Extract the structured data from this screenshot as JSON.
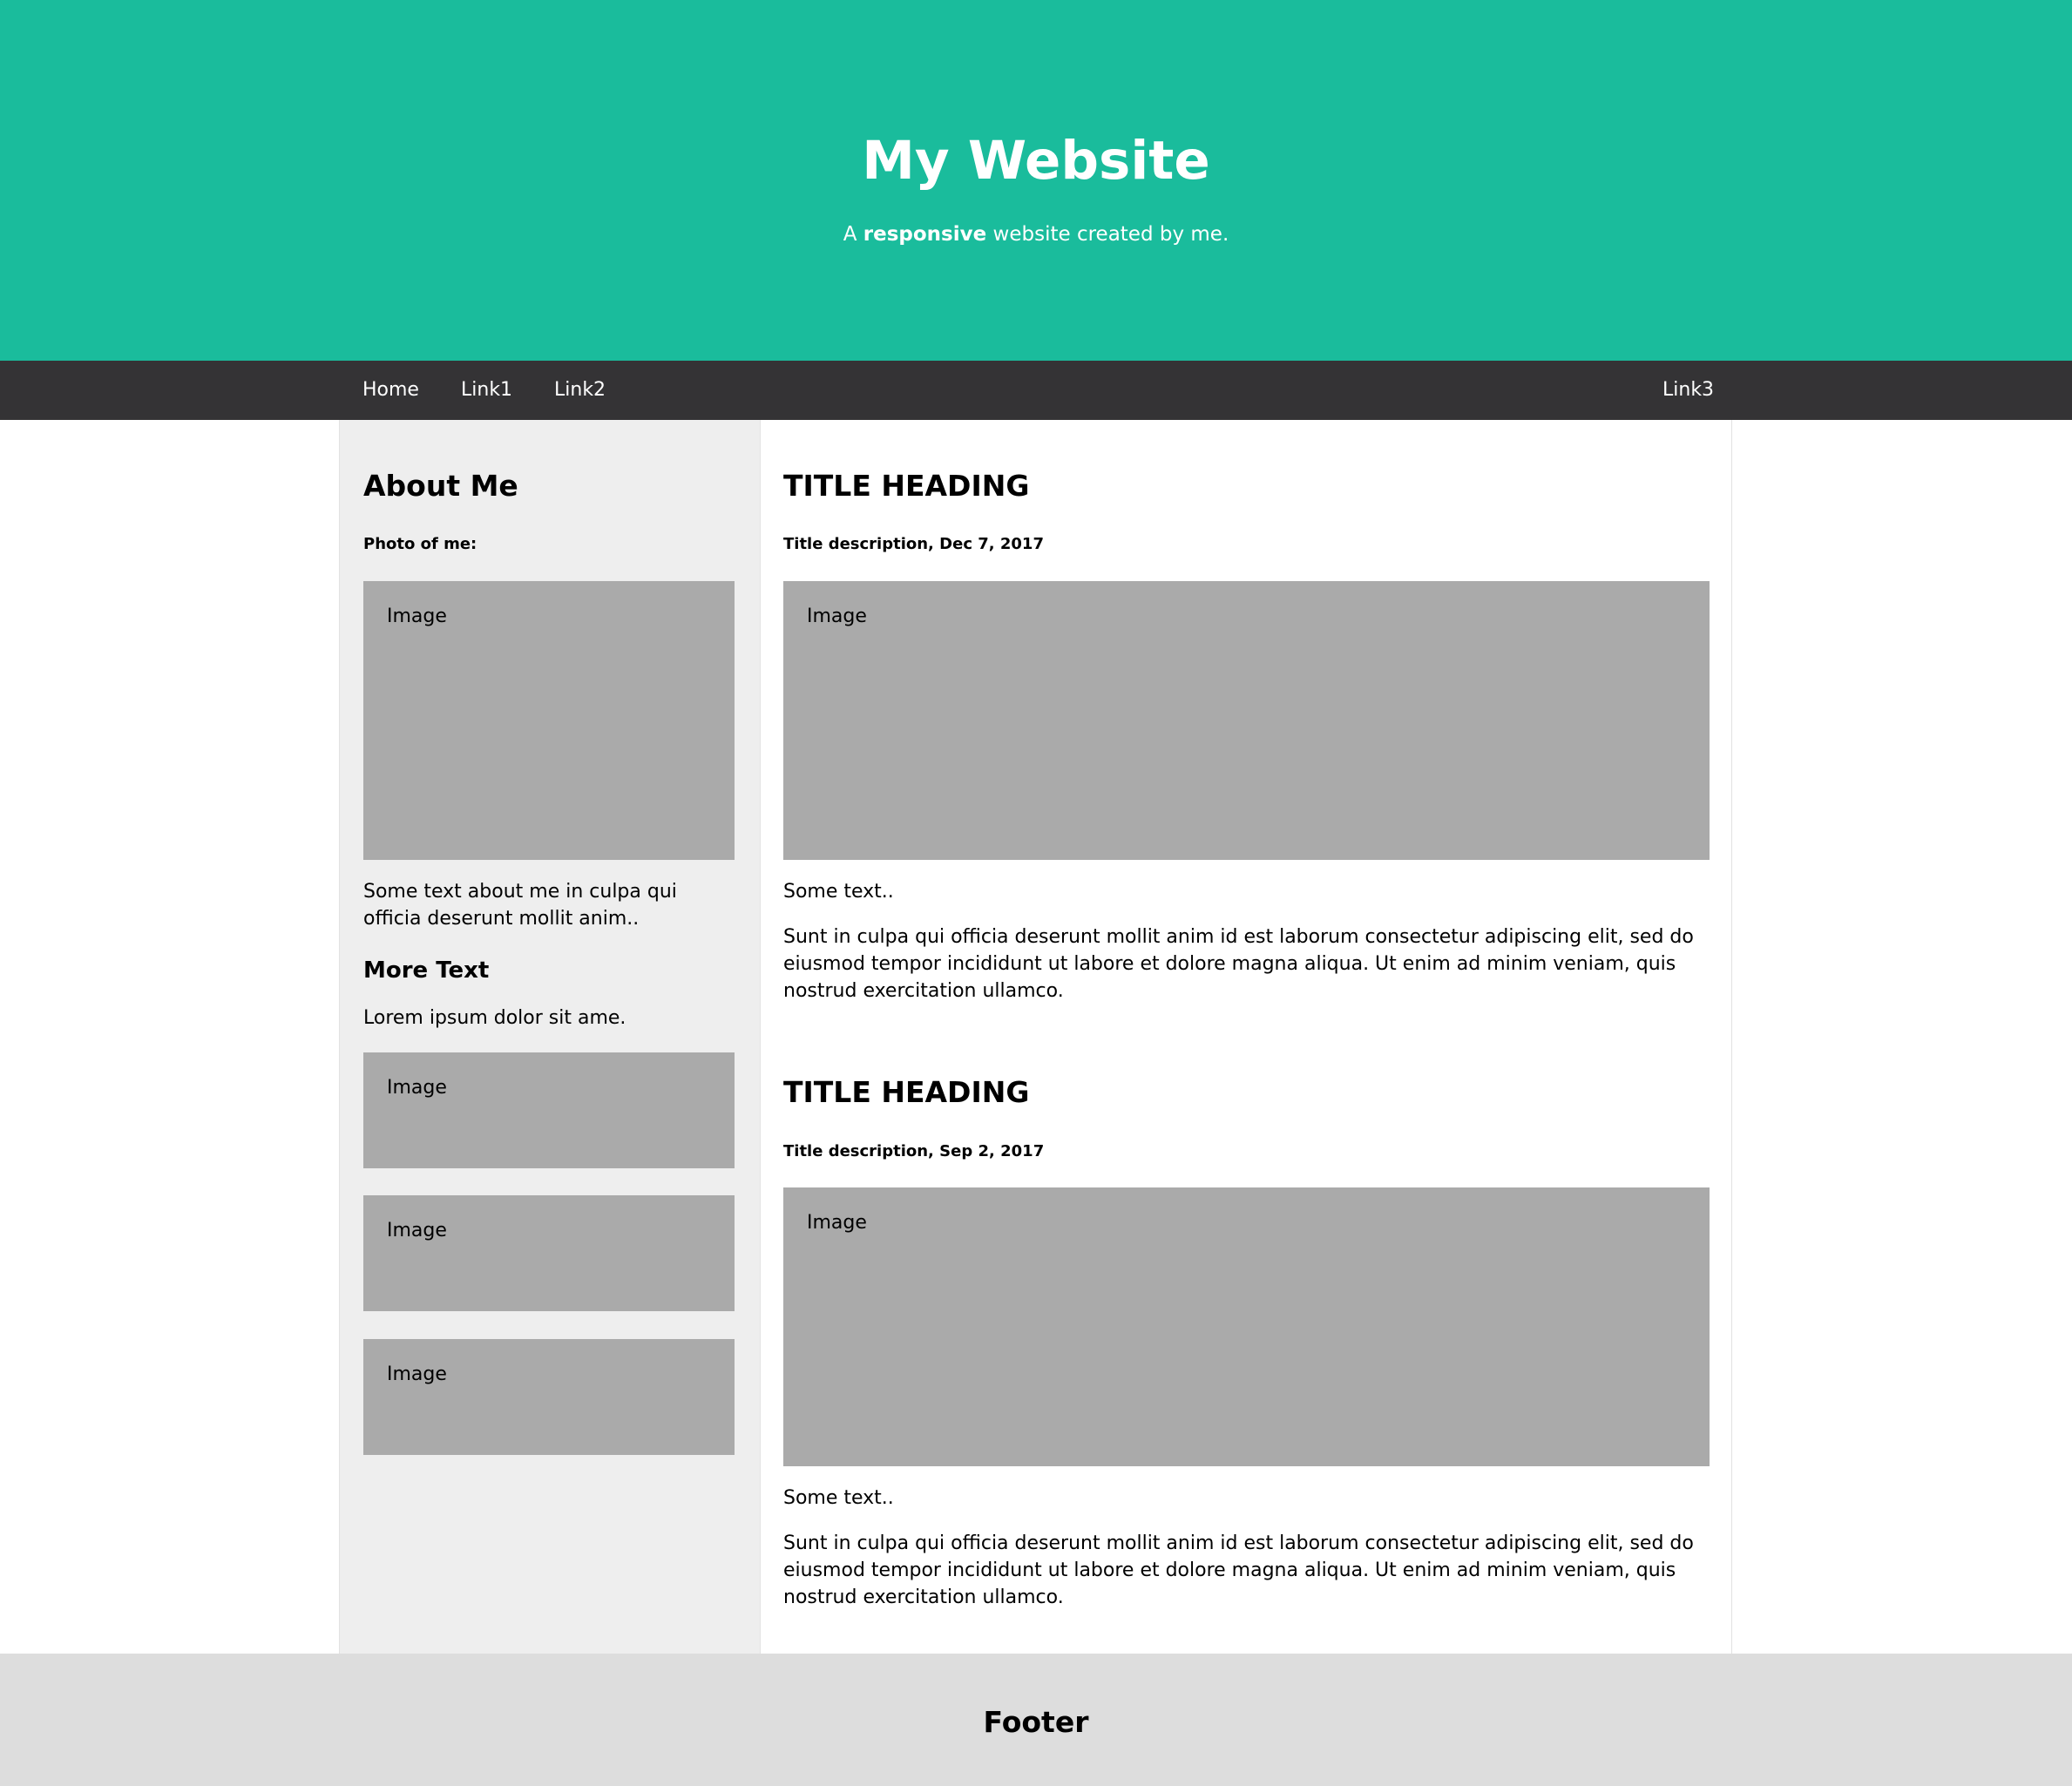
{
  "header": {
    "title": "My Website",
    "subtitle_prefix": "A ",
    "subtitle_bold": "responsive",
    "subtitle_suffix": " website created by me."
  },
  "nav": {
    "links": [
      "Home",
      "Link1",
      "Link2"
    ],
    "right_link": "Link3"
  },
  "sidebar": {
    "heading": "About Me",
    "photo_label": "Photo of me:",
    "photo_placeholder": "Image",
    "about_text": "Some text about me in culpa qui officia deserunt mollit anim..",
    "more_heading": "More Text",
    "more_text": "Lorem ipsum dolor sit ame.",
    "images": [
      "Image",
      "Image",
      "Image"
    ]
  },
  "posts": [
    {
      "title": "TITLE HEADING",
      "description": "Title description, Dec 7, 2017",
      "image": "Image",
      "short_text": "Some text..",
      "body": "Sunt in culpa qui officia deserunt mollit anim id est laborum consectetur adipiscing elit, sed do eiusmod tempor incididunt ut labore et dolore magna aliqua. Ut enim ad minim veniam, quis nostrud exercitation ullamco."
    },
    {
      "title": "TITLE HEADING",
      "description": "Title description, Sep 2, 2017",
      "image": "Image",
      "short_text": "Some text..",
      "body": "Sunt in culpa qui officia deserunt mollit anim id est laborum consectetur adipiscing elit, sed do eiusmod tempor incididunt ut labore et dolore magna aliqua. Ut enim ad minim veniam, quis nostrud exercitation ullamco."
    }
  ],
  "footer": {
    "title": "Footer"
  },
  "colors": {
    "header_bg": "#1abc9c",
    "nav_bg": "#343335",
    "sidebar_bg": "#eeeeee",
    "placeholder_bg": "#aaaaaa",
    "footer_bg": "#dddddd"
  }
}
